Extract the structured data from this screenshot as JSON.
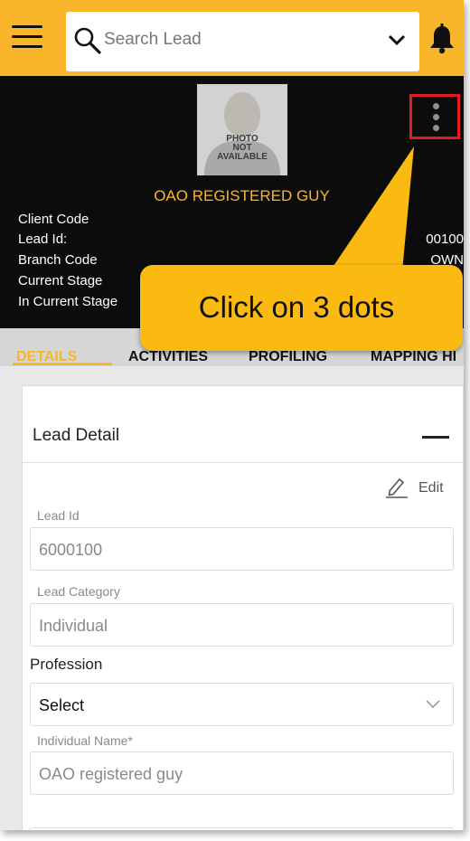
{
  "search": {
    "placeholder": "Search Lead"
  },
  "profile": {
    "photo_text": [
      "PHOTO",
      "NOT",
      "AVAILABLE"
    ],
    "name": "OAO REGISTERED GUY",
    "fields": [
      {
        "label": "Client Code",
        "value": ""
      },
      {
        "label": "Lead Id:",
        "value": "00100"
      },
      {
        "label": "Branch Code",
        "value": "OWN"
      },
      {
        "label": "Current Stage",
        "value": ""
      },
      {
        "label": "In Current Stage",
        "value": ""
      }
    ]
  },
  "callout": {
    "text": "Click on 3 dots"
  },
  "tabs": [
    "DETAILS",
    "ACTIVITIES",
    "PROFILING",
    "MAPPING HI"
  ],
  "card": {
    "title": "Lead Detail",
    "edit_label": "Edit",
    "lead_id": {
      "label": "Lead Id",
      "value": "6000100"
    },
    "lead_category": {
      "label": "Lead Category",
      "value": "Individual"
    },
    "profession": {
      "label": "Profession",
      "value": "Select"
    },
    "individual_name": {
      "label": "Individual Name*",
      "value": "OAO registered guy"
    }
  },
  "icons": {
    "menu": "hamburger-icon",
    "search": "search-icon",
    "dropdown": "chevron-down-icon",
    "notifications": "bell-icon",
    "more": "vertical-dots-icon",
    "edit": "pencil-icon",
    "collapse": "minus-icon"
  },
  "colors": {
    "brand": "#f9b62b",
    "header_bg": "#0c0c0c",
    "highlight": "#e21d1d",
    "callout": "#fbba12"
  }
}
